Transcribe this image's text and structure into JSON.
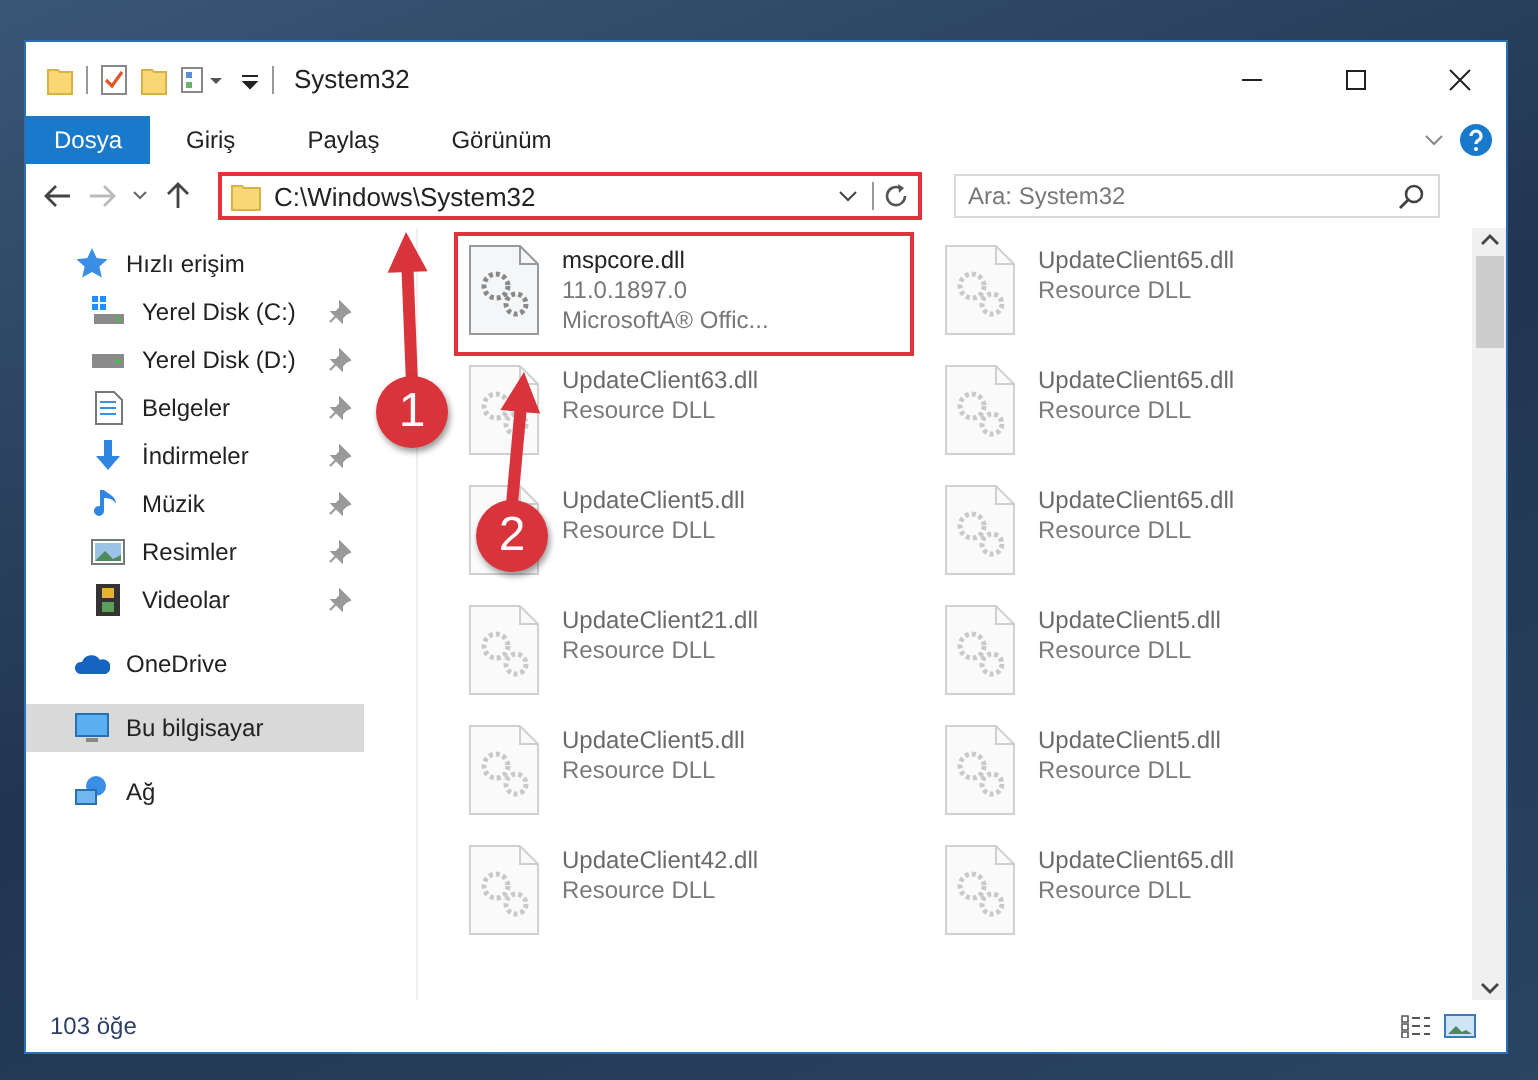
{
  "window": {
    "title": "System32"
  },
  "ribbon": {
    "tabs": [
      {
        "label": "Dosya",
        "kind": "file-menu",
        "selected": false
      },
      {
        "label": "Giriş",
        "kind": "tab",
        "selected": false
      },
      {
        "label": "Paylaş",
        "kind": "tab",
        "selected": false
      },
      {
        "label": "Görünüm",
        "kind": "tab",
        "selected": false
      }
    ]
  },
  "address_bar": {
    "path": "C:\\Windows\\System32",
    "highlighted": true
  },
  "search": {
    "placeholder": "Ara: System32"
  },
  "navigation_pane": {
    "items": [
      {
        "label": "Hızlı erişim",
        "selected": false,
        "children": [
          {
            "label": "Yerel Disk (C:)",
            "pinned": true
          },
          {
            "label": "Yerel Disk (D:)",
            "pinned": true
          },
          {
            "label": "Belgeler",
            "pinned": true
          },
          {
            "label": "İndirmeler",
            "pinned": true
          },
          {
            "label": "Müzik",
            "pinned": true
          },
          {
            "label": "Resimler",
            "pinned": true
          },
          {
            "label": "Videolar",
            "pinned": true
          }
        ]
      },
      {
        "label": "OneDrive",
        "selected": false
      },
      {
        "label": "Bu bilgisayar",
        "selected": true
      },
      {
        "label": "Ağ",
        "selected": false
      }
    ]
  },
  "files": [
    {
      "name": "mspcore.dll",
      "lines": [
        "11.0.1897.0",
        "MicrosoftA® Offic..."
      ],
      "highlighted": true,
      "blurred": false
    },
    {
      "name": "UpdateClient65.dll",
      "lines": [
        "Resource DLL"
      ],
      "highlighted": false,
      "blurred": true
    },
    {
      "name": "UpdateClient63.dll",
      "lines": [
        "Resource DLL"
      ],
      "highlighted": false,
      "blurred": true
    },
    {
      "name": "UpdateClient65.dll",
      "lines": [
        "Resource DLL"
      ],
      "highlighted": false,
      "blurred": true
    },
    {
      "name": "UpdateClient5.dll",
      "lines": [
        "Resource DLL"
      ],
      "highlighted": false,
      "blurred": true
    },
    {
      "name": "UpdateClient65.dll",
      "lines": [
        "Resource DLL"
      ],
      "highlighted": false,
      "blurred": true
    },
    {
      "name": "UpdateClient21.dll",
      "lines": [
        "Resource DLL"
      ],
      "highlighted": false,
      "blurred": true
    },
    {
      "name": "UpdateClient5.dll",
      "lines": [
        "Resource DLL"
      ],
      "highlighted": false,
      "blurred": true
    },
    {
      "name": "UpdateClient5.dll",
      "lines": [
        "Resource DLL"
      ],
      "highlighted": false,
      "blurred": true
    },
    {
      "name": "UpdateClient5.dll",
      "lines": [
        "Resource DLL"
      ],
      "highlighted": false,
      "blurred": true
    },
    {
      "name": "UpdateClient42.dll",
      "lines": [
        "Resource DLL"
      ],
      "highlighted": false,
      "blurred": true
    },
    {
      "name": "UpdateClient65.dll",
      "lines": [
        "Resource DLL"
      ],
      "highlighted": false,
      "blurred": true
    }
  ],
  "status_bar": {
    "item_count": "103 öğe"
  },
  "annotations": [
    {
      "number": "1"
    },
    {
      "number": "2"
    }
  ]
}
